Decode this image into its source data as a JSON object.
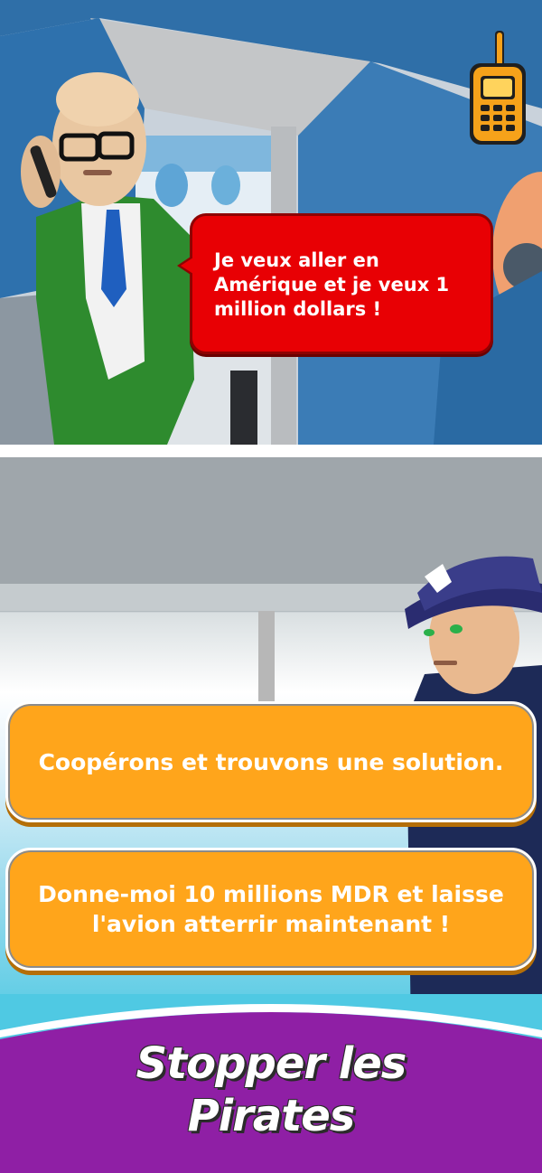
{
  "dialogue": {
    "speaker_line": "Je veux aller en Amérique et je veux 1 million dollars !"
  },
  "choices": [
    {
      "label": "Coopérons et trouvons une solution."
    },
    {
      "label": "Donne-moi 10 millions MDR et laisse l'avion atterrir maintenant !"
    }
  ],
  "banner": {
    "title_line1": "Stopper les",
    "title_line2": "Pirates"
  },
  "icons": {
    "radio": "walkie-talkie-icon"
  },
  "colors": {
    "bubble": "#e80004",
    "choice": "#ffa51b",
    "banner": "#8f1fa5"
  }
}
